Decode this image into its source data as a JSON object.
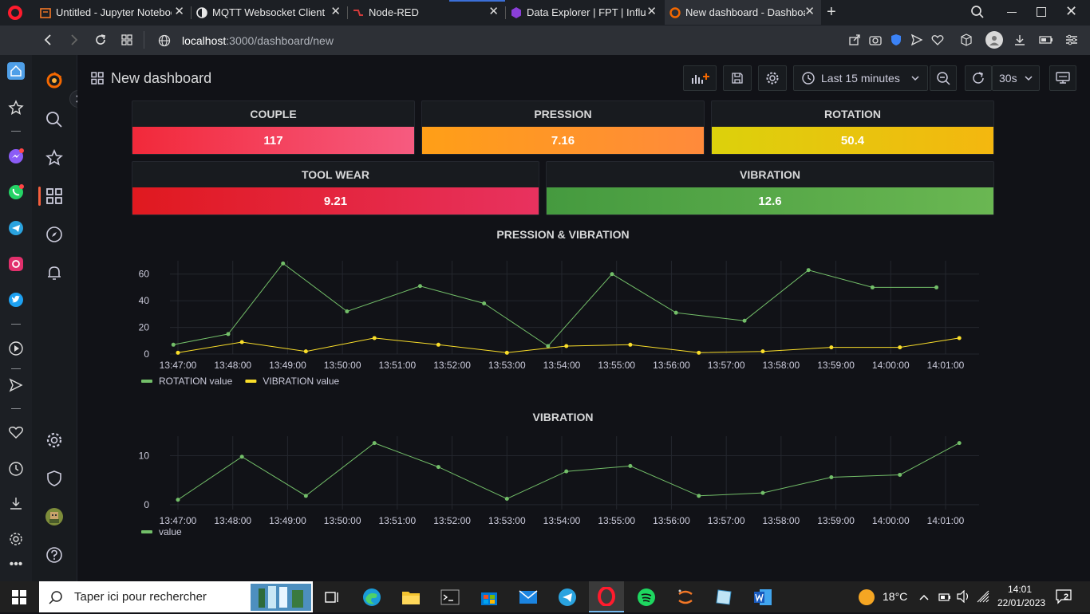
{
  "browser": {
    "tabs": [
      {
        "title": "Untitled - Jupyter Notebook",
        "icon": "jupyter-icon",
        "active": false
      },
      {
        "title": "MQTT Websocket Client",
        "icon": "mqtt-icon",
        "active": false
      },
      {
        "title": "Node-RED",
        "icon": "node-red-icon",
        "active": false
      },
      {
        "title": "Data Explorer | FPT | InfluxDB",
        "icon": "influxdb-icon",
        "active": false
      },
      {
        "title": "New dashboard - Dashboards - Grafana",
        "icon": "grafana-icon",
        "active": true
      }
    ],
    "url_host": "localhost",
    "url_path": ":3000/dashboard/new"
  },
  "dashboard": {
    "title": "New dashboard",
    "time_range": "Last 15 minutes",
    "refresh": "30s"
  },
  "stats": [
    {
      "title": "COUPLE",
      "value": "117",
      "color_from": "#f2293a",
      "color_to": "#f65b80"
    },
    {
      "title": "PRESSION",
      "value": "7.16",
      "color_from": "#ff9f17",
      "color_to": "#ff8a3b"
    },
    {
      "title": "ROTATION",
      "value": "50.4",
      "color_from": "#dcd10c",
      "color_to": "#f4b70f"
    },
    {
      "title": "TOOL WEAR",
      "value": "9.21",
      "color_from": "#e0191f",
      "color_to": "#e8325f"
    },
    {
      "title": "VIBRATION",
      "value": "12.6",
      "color_from": "#459a3f",
      "color_to": "#6ab752"
    }
  ],
  "chart_data": [
    {
      "type": "line",
      "title": "PRESSION & VIBRATION",
      "x_ticks": [
        "13:47:00",
        "13:48:00",
        "13:49:00",
        "13:50:00",
        "13:51:00",
        "13:52:00",
        "13:53:00",
        "13:54:00",
        "13:55:00",
        "13:56:00",
        "13:57:00",
        "13:58:00",
        "13:59:00",
        "14:00:00",
        "14:01:00"
      ],
      "y_ticks": [
        0,
        20,
        40,
        60
      ],
      "ylim": [
        0,
        70
      ],
      "grid": true,
      "legend": "bottom-left",
      "series": [
        {
          "name": "ROTATION value",
          "color": "#73bf69",
          "x": [
            "13:46:55",
            "13:47:55",
            "13:48:55",
            "13:50:05",
            "13:51:25",
            "13:52:35",
            "13:53:45",
            "13:54:55",
            "13:56:05",
            "13:57:20",
            "13:58:30",
            "13:59:40",
            "14:00:50"
          ],
          "values": [
            7,
            15,
            68,
            32,
            51,
            38,
            6,
            60,
            31,
            25,
            63,
            50,
            50
          ]
        },
        {
          "name": "VIBRATION value",
          "color": "#fade2a",
          "x": [
            "13:47:00",
            "13:48:10",
            "13:49:20",
            "13:50:35",
            "13:51:45",
            "13:53:00",
            "13:54:05",
            "13:55:15",
            "13:56:30",
            "13:57:40",
            "13:58:55",
            "14:00:10",
            "14:01:15"
          ],
          "values": [
            1,
            9,
            2,
            12,
            7,
            1,
            6,
            7,
            1,
            2,
            5,
            5,
            12
          ]
        }
      ]
    },
    {
      "type": "line",
      "title": "VIBRATION",
      "x_ticks": [
        "13:47:00",
        "13:48:00",
        "13:49:00",
        "13:50:00",
        "13:51:00",
        "13:52:00",
        "13:53:00",
        "13:54:00",
        "13:55:00",
        "13:56:00",
        "13:57:00",
        "13:58:00",
        "13:59:00",
        "14:00:00",
        "14:01:00"
      ],
      "y_ticks": [
        0,
        10
      ],
      "ylim": [
        -1,
        14
      ],
      "grid": true,
      "legend": "bottom-left",
      "series": [
        {
          "name": "value",
          "color": "#73bf69",
          "x": [
            "13:47:00",
            "13:48:10",
            "13:49:20",
            "13:50:35",
            "13:51:45",
            "13:53:00",
            "13:54:05",
            "13:55:15",
            "13:56:30",
            "13:57:40",
            "13:58:55",
            "14:00:10",
            "14:01:15"
          ],
          "values": [
            1,
            9.8,
            1.8,
            12.6,
            7.7,
            1.2,
            6.8,
            7.9,
            1.8,
            2.4,
            5.6,
            6.1,
            12.6
          ]
        }
      ]
    }
  ],
  "taskbar": {
    "search_placeholder": "Taper ici pour rechercher",
    "weather": "18°C",
    "time": "14:01",
    "date": "22/01/2023",
    "notifications": "2"
  }
}
